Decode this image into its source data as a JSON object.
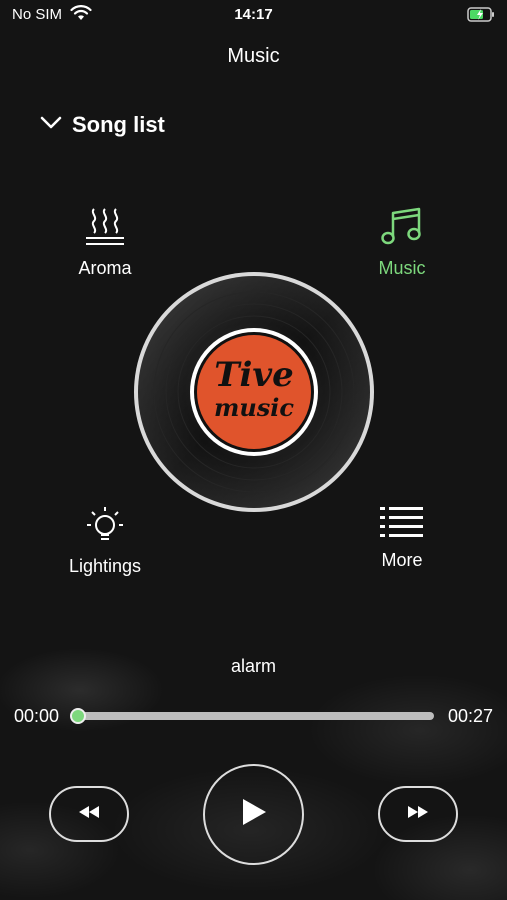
{
  "status_bar": {
    "carrier": "No SIM",
    "time": "14:17"
  },
  "header": {
    "title": "Music"
  },
  "song_list": {
    "label": "Song list"
  },
  "features": {
    "aroma": "Aroma",
    "music": "Music",
    "lightings": "Lightings",
    "more": "More"
  },
  "disc": {
    "label_line1": "Tive",
    "label_line2": "music"
  },
  "player": {
    "song_title": "alarm",
    "current_time": "00:00",
    "total_time": "00:27",
    "progress": 0.0
  },
  "colors": {
    "accent": "#7dd87d",
    "disc_label": "#e0542c"
  },
  "icons": [
    "wifi-icon",
    "battery-charging-icon",
    "chevron-down-icon",
    "aroma-icon",
    "music-note-icon",
    "lightbulb-icon",
    "list-icon",
    "rewind-icon",
    "play-icon",
    "fast-forward-icon"
  ]
}
